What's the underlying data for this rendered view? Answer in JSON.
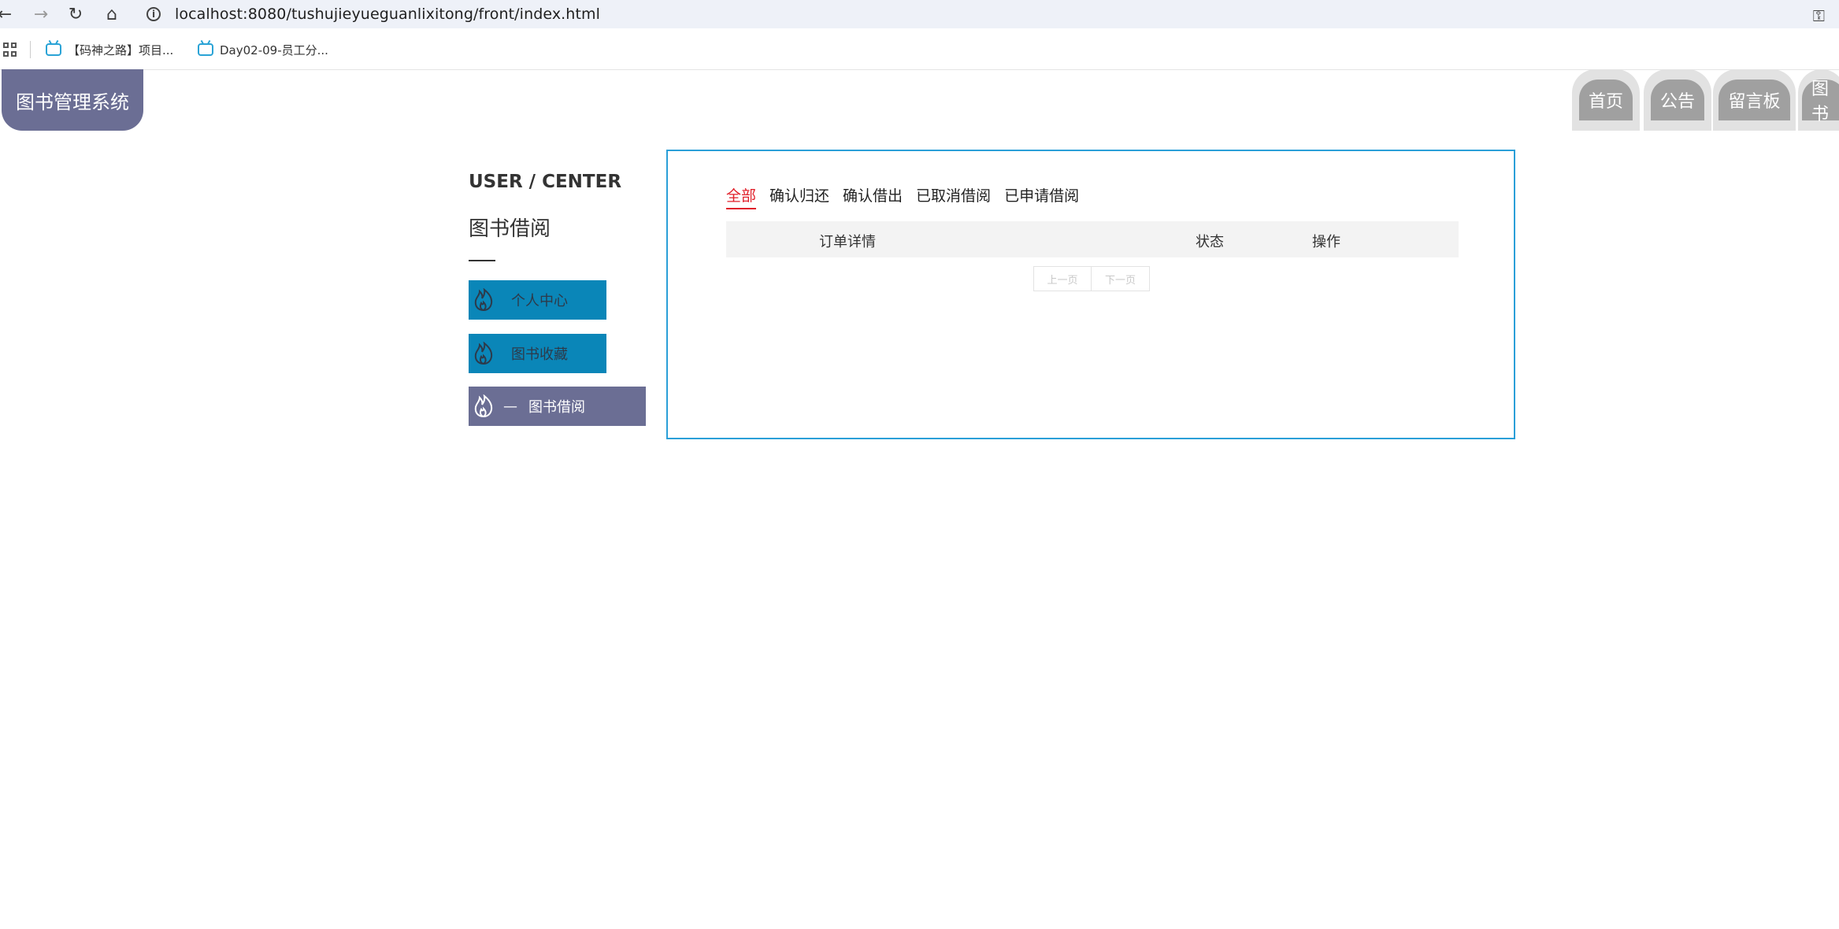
{
  "browser": {
    "url": "localhost:8080/tushujieyueguanlixitong/front/index.html",
    "bookmarks": [
      "【码神之路】项目...",
      "Day02-09-员工分..."
    ]
  },
  "header": {
    "logo": "图书管理系统",
    "nav": [
      "首页",
      "公告",
      "留言板",
      "图书"
    ]
  },
  "sidebar": {
    "title": "USER / CENTER",
    "subtitle": "图书借阅",
    "active_prefix": "—",
    "items": [
      {
        "label": "个人中心",
        "active": false
      },
      {
        "label": "图书收藏",
        "active": false
      },
      {
        "label": "图书借阅",
        "active": true
      }
    ]
  },
  "main": {
    "tabs": [
      "全部",
      "确认归还",
      "确认借出",
      "已取消借阅",
      "已申请借阅"
    ],
    "active_tab": "全部",
    "table_headers": [
      "订单详情",
      "状态",
      "操作"
    ],
    "rows": [],
    "pager": {
      "prev": "上一页",
      "next": "下一页"
    }
  },
  "colors": {
    "accent": "#6b6e94",
    "menu_blue": "#0a86b8",
    "panel_border": "#2a9fd8",
    "active_tab": "#e0202a"
  }
}
